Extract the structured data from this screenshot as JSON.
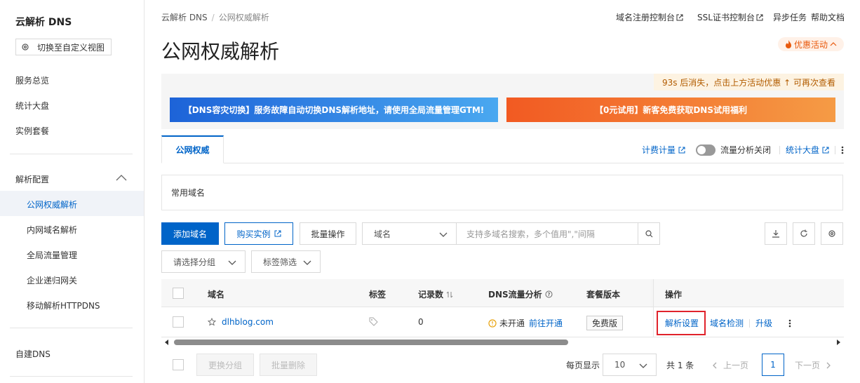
{
  "sidebar": {
    "title": "云解析 DNS",
    "switch_view": "切换至自定义视图",
    "items": [
      "服务总览",
      "统计大盘",
      "实例套餐"
    ],
    "group_label": "解析配置",
    "sub_items": [
      "公网权威解析",
      "内网域名解析",
      "全局流量管理",
      "企业递归网关",
      "移动解析HTTPDNS"
    ],
    "bottom_item": "自建DNS"
  },
  "header": {
    "breadcrumb": [
      "云解析 DNS",
      "公网权威解析"
    ],
    "links": [
      "域名注册控制台",
      "SSL证书控制台",
      "异步任务",
      "帮助文档"
    ],
    "title": "公网权威解析",
    "promo_tag": "优惠活动"
  },
  "banner": {
    "note": "93s 后消失，点击上方活动优惠 ↑ 可再次查看",
    "left": "【DNS容灾切换】服务故障自动切换DNS解析地址，请使用全局流量管理GTM!",
    "right": "【0元试用】新客免费获取DNS试用福利"
  },
  "tabs": {
    "active": "公网权威",
    "billing": "计费计量",
    "traffic_toggle": "流量分析关闭",
    "stats": "统计大盘"
  },
  "common_domains": "常用域名",
  "toolbar": {
    "add_domain": "添加域名",
    "buy_instance": "购买实例",
    "batch_ops": "批量操作",
    "field_select": "域名",
    "search_placeholder": "支持多域名搜索，多个值用\",\"间隔",
    "group_select": "请选择分组",
    "tag_filter": "标签筛选"
  },
  "table": {
    "headers": {
      "domain": "域名",
      "tags": "标签",
      "records": "记录数",
      "dns_traffic": "DNS流量分析",
      "package": "套餐版本",
      "ops": "操作"
    },
    "rows": [
      {
        "domain": "dlhblog.com",
        "records": "0",
        "traffic_status": "未开通",
        "traffic_action": "前往开通",
        "package": "免费版",
        "op_settings": "解析设置",
        "op_check": "域名检测",
        "op_upgrade": "升级"
      }
    ]
  },
  "footer": {
    "change_group": "更换分组",
    "batch_delete": "批量删除",
    "per_page_label": "每页显示",
    "per_page": "10",
    "total": "共 1 条",
    "prev": "上一页",
    "page": "1",
    "next": "下一页"
  },
  "colors": {
    "accent": "#0064c8",
    "highlight": "#e0232b",
    "warning": "#e8a20c"
  }
}
